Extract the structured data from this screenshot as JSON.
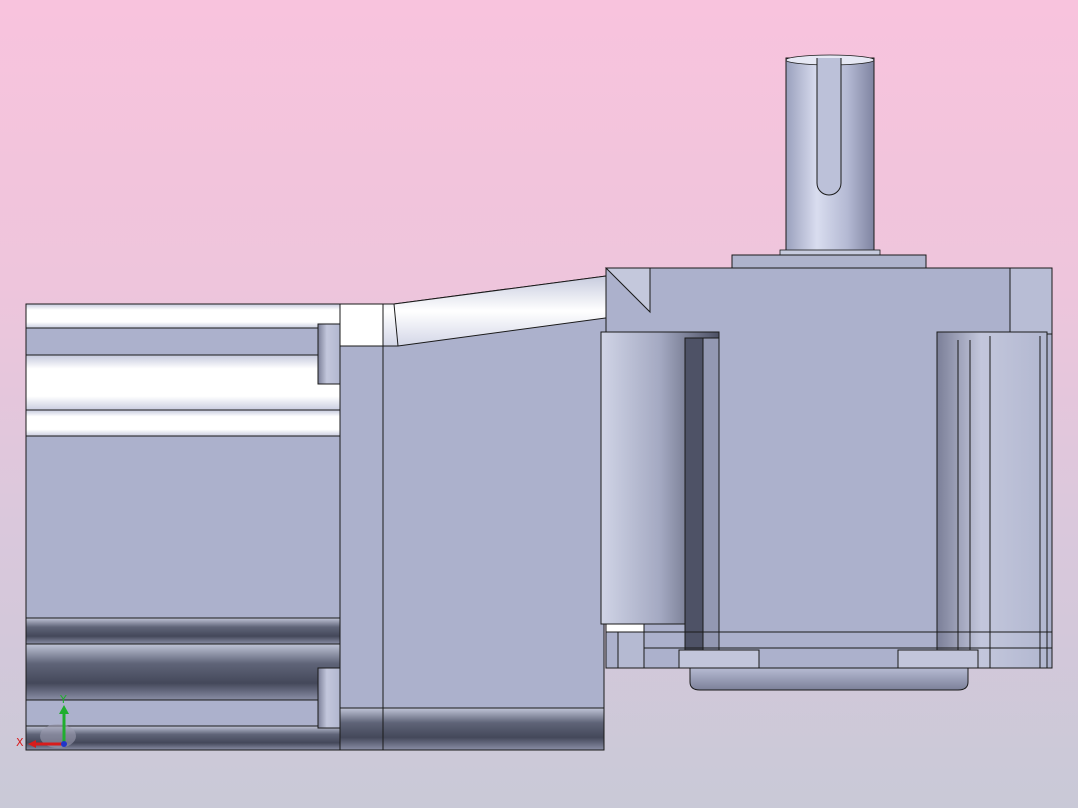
{
  "viewport": {
    "background_top": "#f8c3dd",
    "background_bottom": "#c9c9d7",
    "body_color": "#acb1cc",
    "edge_color": "#1a1a1a"
  },
  "triad": {
    "x_label": "X",
    "y_label": "Y",
    "x_color": "#d81c1c",
    "y_color": "#1fae2e",
    "z_color": "#2236c8"
  }
}
